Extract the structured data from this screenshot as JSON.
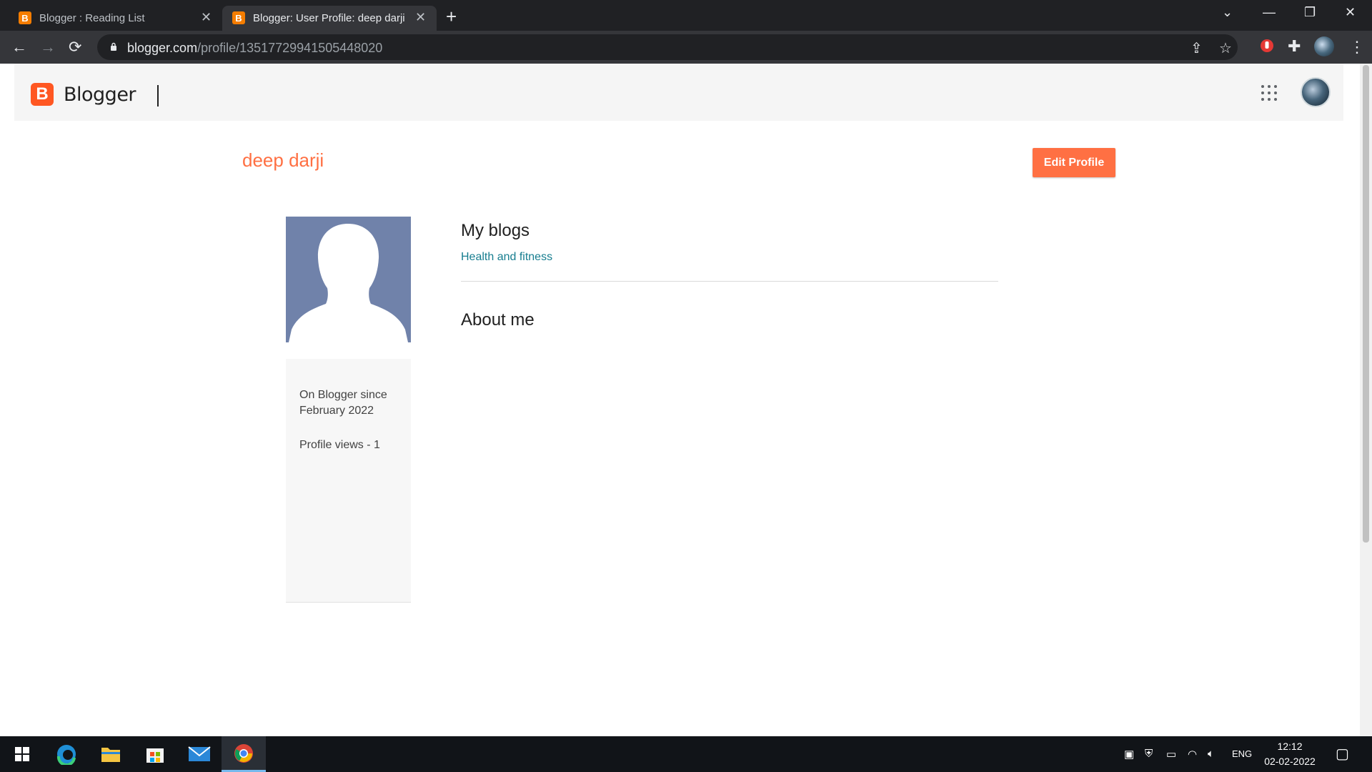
{
  "browser": {
    "tabs": [
      {
        "title": "Blogger : Reading List",
        "favicon": "blogger-favicon"
      },
      {
        "title": "Blogger: User Profile: deep darji",
        "favicon": "blogger-favicon",
        "active": true
      }
    ],
    "favicon_letter": "B",
    "url_host": "blogger.com",
    "url_path": "/profile/13517729941505448020"
  },
  "header": {
    "logo_letter": "B",
    "brand": "Blogger"
  },
  "profile": {
    "name": "deep darji",
    "edit_label": "Edit Profile",
    "since_line1": "On Blogger since",
    "since_line2": "February 2022",
    "views": "Profile views - 1"
  },
  "blogs": {
    "heading": "My blogs",
    "items": [
      "Health and fitness"
    ]
  },
  "about": {
    "heading": "About me"
  },
  "taskbar": {
    "lang": "ENG",
    "time": "12:12",
    "date": "02-02-2022"
  },
  "colors": {
    "accent": "#ff7043",
    "brand_orange": "#ff5722",
    "link": "#167d8f"
  }
}
